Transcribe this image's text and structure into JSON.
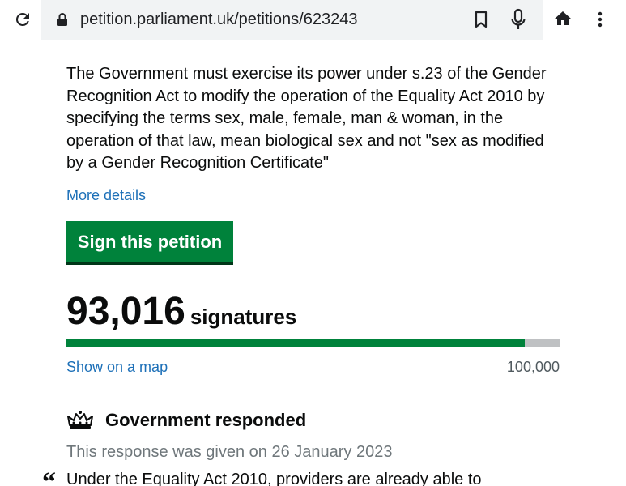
{
  "browser": {
    "url": "petition.parliament.uk/petitions/623243",
    "icons": [
      "reload-icon",
      "lock-icon",
      "bookmark-icon",
      "mic-icon",
      "home-icon",
      "more-vert-icon"
    ]
  },
  "petition": {
    "action_text": "The Government must exercise its power under s.23 of the Gender Recognition Act to modify the operation of the Equality Act 2010 by specifying the terms sex, male, female, man & woman, in the operation of that law, mean biological sex and not \"sex as modified by a Gender Recognition Certificate\"",
    "more_details_label": "More details",
    "sign_button_label": "Sign this petition",
    "signature_count": "93,016",
    "signature_label": "signatures",
    "progress_fraction": 0.93016,
    "map_link_label": "Show on a map",
    "threshold": "100,000"
  },
  "response": {
    "heading": "Government responded",
    "date_text": "This response was given on 26 January 2023",
    "quote_mark": "“",
    "quote_start": "Under the Equality Act 2010, providers are already able to"
  },
  "colors": {
    "link": "#1d70b8",
    "button_green": "#00823b",
    "progress_track": "#bfc1c3",
    "text": "#0b0c0c",
    "secondary_text": "#6f777b"
  }
}
